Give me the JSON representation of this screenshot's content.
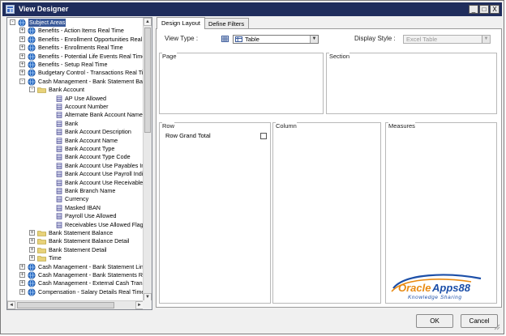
{
  "window": {
    "title": "View Designer",
    "controls": [
      "_",
      "□",
      "X"
    ]
  },
  "tree": {
    "items": [
      {
        "label": "Subject Areas",
        "level": 0,
        "icon": "globe-icon",
        "expander": "−",
        "selected": true
      },
      {
        "label": "Benefits - Action Items Real Time",
        "level": 1,
        "icon": "globe-icon",
        "expander": "+"
      },
      {
        "label": "Benefits - Enrollment Opportunities Real T",
        "level": 1,
        "icon": "globe-icon",
        "expander": "+"
      },
      {
        "label": "Benefits - Enrollments Real Time",
        "level": 1,
        "icon": "globe-icon",
        "expander": "+"
      },
      {
        "label": "Benefits - Potential Life Events Real Time",
        "level": 1,
        "icon": "globe-icon",
        "expander": "+"
      },
      {
        "label": "Benefits - Setup Real Time",
        "level": 1,
        "icon": "globe-icon",
        "expander": "+"
      },
      {
        "label": "Budgetary Control - Transactions Real Ti",
        "level": 1,
        "icon": "globe-icon",
        "expander": "+"
      },
      {
        "label": "Cash Management - Bank Statement Bal",
        "level": 1,
        "icon": "globe-icon",
        "expander": "−"
      },
      {
        "label": "Bank Account",
        "level": 2,
        "icon": "folder-icon",
        "expander": "−"
      },
      {
        "label": "AP Use Allowed",
        "level": 3,
        "icon": "column-icon"
      },
      {
        "label": "Account Number",
        "level": 3,
        "icon": "column-icon"
      },
      {
        "label": "Alternate Bank Account Name",
        "level": 3,
        "icon": "column-icon"
      },
      {
        "label": "Bank",
        "level": 3,
        "icon": "column-icon"
      },
      {
        "label": "Bank Account Description",
        "level": 3,
        "icon": "column-icon"
      },
      {
        "label": "Bank Account Name",
        "level": 3,
        "icon": "column-icon"
      },
      {
        "label": "Bank Account Type",
        "level": 3,
        "icon": "column-icon"
      },
      {
        "label": "Bank Account Type Code",
        "level": 3,
        "icon": "column-icon"
      },
      {
        "label": "Bank Account Use Payables Ind",
        "level": 3,
        "icon": "column-icon"
      },
      {
        "label": "Bank Account Use Payroll Indica",
        "level": 3,
        "icon": "column-icon"
      },
      {
        "label": "Bank Account Use Receivables",
        "level": 3,
        "icon": "column-icon"
      },
      {
        "label": "Bank Branch Name",
        "level": 3,
        "icon": "column-icon"
      },
      {
        "label": "Currency",
        "level": 3,
        "icon": "column-icon"
      },
      {
        "label": "Masked IBAN",
        "level": 3,
        "icon": "column-icon"
      },
      {
        "label": "Payroll Use Allowed",
        "level": 3,
        "icon": "column-icon"
      },
      {
        "label": "Receivables Use Allowed Flag D",
        "level": 3,
        "icon": "column-icon"
      },
      {
        "label": "Bank Statement Balance",
        "level": 2,
        "icon": "folder-icon",
        "expander": "+"
      },
      {
        "label": "Bank Statement Balance Detail",
        "level": 2,
        "icon": "folder-icon",
        "expander": "+"
      },
      {
        "label": "Bank Statement Detail",
        "level": 2,
        "icon": "folder-icon",
        "expander": "+"
      },
      {
        "label": "Time",
        "level": 2,
        "icon": "folder-icon",
        "expander": "+"
      },
      {
        "label": "Cash Management - Bank Statement Lin",
        "level": 1,
        "icon": "globe-icon",
        "expander": "+"
      },
      {
        "label": "Cash Management - Bank Statements Re",
        "level": 1,
        "icon": "globe-icon",
        "expander": "+"
      },
      {
        "label": "Cash Management - External Cash Trans",
        "level": 1,
        "icon": "globe-icon",
        "expander": "+"
      },
      {
        "label": "Compensation - Salary Details Real Time",
        "level": 1,
        "icon": "globe-icon",
        "expander": "+"
      }
    ],
    "scrollbar": {
      "up": "▲",
      "down": "▼",
      "left": "◄",
      "right": "►"
    }
  },
  "tabs": [
    {
      "label": "Design Layout",
      "active": true
    },
    {
      "label": "Define Filters",
      "active": false
    }
  ],
  "design": {
    "view_type_label": "View Type :",
    "view_type_value": "Table",
    "display_style_label": "Display Style :",
    "display_style_value": "Excel Table",
    "dropdown_arrow": "▼",
    "page_label": "Page",
    "section_label": "Section",
    "row_label": "Row",
    "column_label": "Column",
    "measures_label": "Measures",
    "row_grand_total_label": "Row Grand Total",
    "row_grand_total_checked": false
  },
  "watermark": {
    "brand": "OracleApps88",
    "tagline": "Knowledge Sharing"
  },
  "buttons": {
    "ok": "OK",
    "cancel": "Cancel"
  },
  "colors": {
    "titlebar": "#1f2d5c",
    "selection": "#3a5a9a",
    "folder": "#e8d27a",
    "globe": "#2b6cc4",
    "column_icon": "#3a3a8a",
    "watermark_blue": "#1c4fa8",
    "watermark_orange": "#e88a12"
  }
}
